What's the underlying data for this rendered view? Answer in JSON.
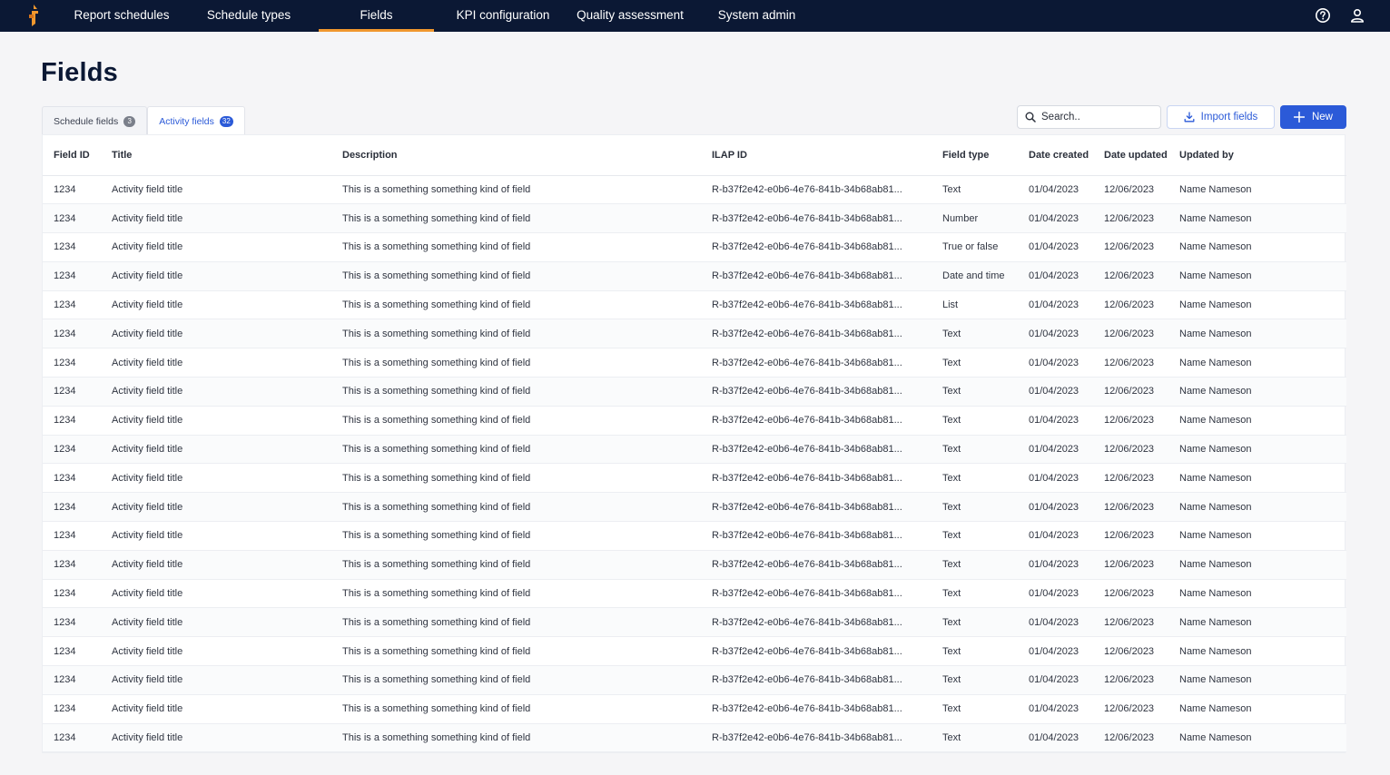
{
  "nav": {
    "items": [
      "Report schedules",
      "Schedule types",
      "Fields",
      "KPI configuration",
      "Quality assessment",
      "System admin"
    ],
    "active": "Fields",
    "brand_color": "#0b1834",
    "accent_color": "#f0972e"
  },
  "page": {
    "title": "Fields"
  },
  "tabs": [
    {
      "label": "Schedule fields",
      "count": "3"
    },
    {
      "label": "Activity fields",
      "count": "32"
    }
  ],
  "toolbar": {
    "search_placeholder": "Search..",
    "import_label": "Import fields",
    "new_label": "New",
    "primary_color": "#2b5ad8"
  },
  "table": {
    "headers": [
      "Field ID",
      "Title",
      "Description",
      "ILAP ID",
      "Field type",
      "Date created",
      "Date updated",
      "Updated by"
    ],
    "rows": [
      [
        "1234",
        "Activity field title",
        "This is a something something kind of field",
        "R-b37f2e42-e0b6-4e76-841b-34b68ab81...",
        "Text",
        "01/04/2023",
        "12/06/2023",
        "Name Nameson"
      ],
      [
        "1234",
        "Activity field title",
        "This is a something something kind of field",
        "R-b37f2e42-e0b6-4e76-841b-34b68ab81...",
        "Number",
        "01/04/2023",
        "12/06/2023",
        "Name Nameson"
      ],
      [
        "1234",
        "Activity field title",
        "This is a something something kind of field",
        "R-b37f2e42-e0b6-4e76-841b-34b68ab81...",
        "True or false",
        "01/04/2023",
        "12/06/2023",
        "Name Nameson"
      ],
      [
        "1234",
        "Activity field title",
        "This is a something something kind of field",
        "R-b37f2e42-e0b6-4e76-841b-34b68ab81...",
        "Date and time",
        "01/04/2023",
        "12/06/2023",
        "Name Nameson"
      ],
      [
        "1234",
        "Activity field title",
        "This is a something something kind of field",
        "R-b37f2e42-e0b6-4e76-841b-34b68ab81...",
        "List",
        "01/04/2023",
        "12/06/2023",
        "Name Nameson"
      ],
      [
        "1234",
        "Activity field title",
        "This is a something something kind of field",
        "R-b37f2e42-e0b6-4e76-841b-34b68ab81...",
        "Text",
        "01/04/2023",
        "12/06/2023",
        "Name Nameson"
      ],
      [
        "1234",
        "Activity field title",
        "This is a something something kind of field",
        "R-b37f2e42-e0b6-4e76-841b-34b68ab81...",
        "Text",
        "01/04/2023",
        "12/06/2023",
        "Name Nameson"
      ],
      [
        "1234",
        "Activity field title",
        "This is a something something kind of field",
        "R-b37f2e42-e0b6-4e76-841b-34b68ab81...",
        "Text",
        "01/04/2023",
        "12/06/2023",
        "Name Nameson"
      ],
      [
        "1234",
        "Activity field title",
        "This is a something something kind of field",
        "R-b37f2e42-e0b6-4e76-841b-34b68ab81...",
        "Text",
        "01/04/2023",
        "12/06/2023",
        "Name Nameson"
      ],
      [
        "1234",
        "Activity field title",
        "This is a something something kind of field",
        "R-b37f2e42-e0b6-4e76-841b-34b68ab81...",
        "Text",
        "01/04/2023",
        "12/06/2023",
        "Name Nameson"
      ],
      [
        "1234",
        "Activity field title",
        "This is a something something kind of field",
        "R-b37f2e42-e0b6-4e76-841b-34b68ab81...",
        "Text",
        "01/04/2023",
        "12/06/2023",
        "Name Nameson"
      ],
      [
        "1234",
        "Activity field title",
        "This is a something something kind of field",
        "R-b37f2e42-e0b6-4e76-841b-34b68ab81...",
        "Text",
        "01/04/2023",
        "12/06/2023",
        "Name Nameson"
      ],
      [
        "1234",
        "Activity field title",
        "This is a something something kind of field",
        "R-b37f2e42-e0b6-4e76-841b-34b68ab81...",
        "Text",
        "01/04/2023",
        "12/06/2023",
        "Name Nameson"
      ],
      [
        "1234",
        "Activity field title",
        "This is a something something kind of field",
        "R-b37f2e42-e0b6-4e76-841b-34b68ab81...",
        "Text",
        "01/04/2023",
        "12/06/2023",
        "Name Nameson"
      ],
      [
        "1234",
        "Activity field title",
        "This is a something something kind of field",
        "R-b37f2e42-e0b6-4e76-841b-34b68ab81...",
        "Text",
        "01/04/2023",
        "12/06/2023",
        "Name Nameson"
      ],
      [
        "1234",
        "Activity field title",
        "This is a something something kind of field",
        "R-b37f2e42-e0b6-4e76-841b-34b68ab81...",
        "Text",
        "01/04/2023",
        "12/06/2023",
        "Name Nameson"
      ],
      [
        "1234",
        "Activity field title",
        "This is a something something kind of field",
        "R-b37f2e42-e0b6-4e76-841b-34b68ab81...",
        "Text",
        "01/04/2023",
        "12/06/2023",
        "Name Nameson"
      ],
      [
        "1234",
        "Activity field title",
        "This is a something something kind of field",
        "R-b37f2e42-e0b6-4e76-841b-34b68ab81...",
        "Text",
        "01/04/2023",
        "12/06/2023",
        "Name Nameson"
      ],
      [
        "1234",
        "Activity field title",
        "This is a something something kind of field",
        "R-b37f2e42-e0b6-4e76-841b-34b68ab81...",
        "Text",
        "01/04/2023",
        "12/06/2023",
        "Name Nameson"
      ],
      [
        "1234",
        "Activity field title",
        "This is a something something kind of field",
        "R-b37f2e42-e0b6-4e76-841b-34b68ab81...",
        "Text",
        "01/04/2023",
        "12/06/2023",
        "Name Nameson"
      ]
    ]
  }
}
